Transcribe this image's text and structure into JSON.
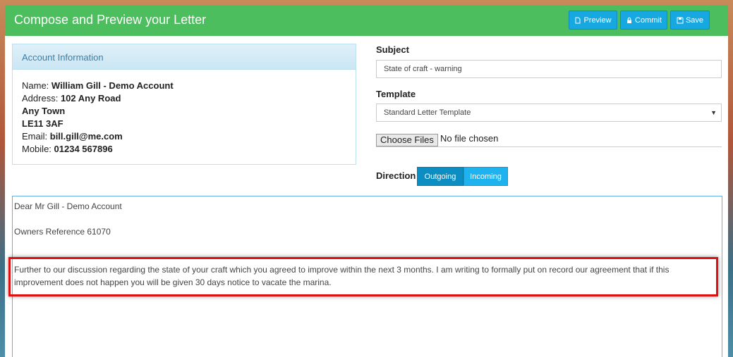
{
  "header": {
    "title": "Compose and Preview your Letter",
    "buttons": {
      "preview": "Preview",
      "commit": "Commit",
      "save": "Save"
    },
    "color": "#4cbe5e"
  },
  "account": {
    "heading": "Account Information",
    "name_label": "Name:",
    "name": "William Gill - Demo Account",
    "address_label": "Address:",
    "address1": "102 Any Road",
    "address2": "Any Town",
    "address3": "LE11 3AF",
    "email_label": "Email:",
    "email": "bill.gill@me.com",
    "mobile_label": "Mobile:",
    "mobile": "01234 567896"
  },
  "form": {
    "subject_label": "Subject",
    "subject_value": "State of craft - warning",
    "template_label": "Template",
    "template_value": "Standard Letter Template",
    "choose_files": "Choose Files",
    "no_file": "No file chosen",
    "direction_label": "Direction",
    "direction_options": [
      "Outgoing",
      "Incoming"
    ],
    "direction_selected": "Outgoing"
  },
  "letter": {
    "greeting": "Dear Mr Gill - Demo Account",
    "reference": "Owners Reference 61070",
    "paragraph1": "Further to our discussion regarding the state of your craft which you agreed to improve within the next 3 months.  I am writing to formally put on record our agreement that if this",
    "paragraph2": "improvement does not happen you will be given 30 days notice to vacate the marina."
  }
}
